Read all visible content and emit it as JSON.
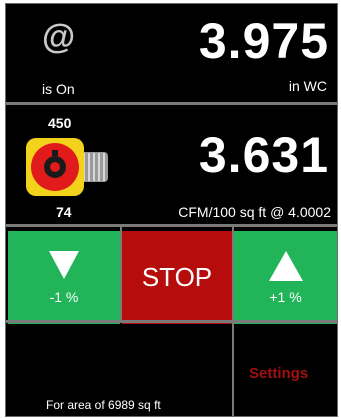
{
  "pressure": {
    "symbol": "@",
    "status": "is On",
    "value": "3.975",
    "unit": "in WC"
  },
  "flow": {
    "gauge_top": "450",
    "gauge_bottom": "74",
    "value": "3.631",
    "unit": "CFM/100 sq ft @ 4.0002",
    "icon": "fan-icon"
  },
  "controls": {
    "decrease_label": "-1 %",
    "stop_label": "STOP",
    "increase_label": "+1 %"
  },
  "footer": {
    "area_text": "For area of 6989 sq ft",
    "settings_label": "Settings"
  },
  "colors": {
    "green": "#21b458",
    "red": "#b60c0c",
    "settings_text": "#a11010",
    "gauge_yellow": "#f2d21b"
  }
}
